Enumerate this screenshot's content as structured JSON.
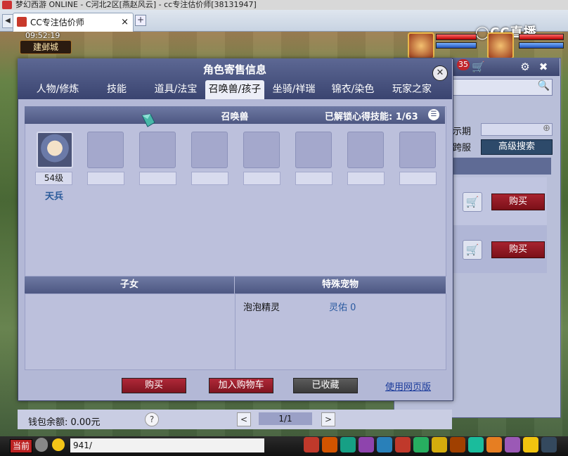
{
  "window": {
    "title": "梦幻西游 ONLINE - C河北2区[燕赵风云] - cc专注估价师[38131947]"
  },
  "browser_tab": {
    "label": "CC专注估价师",
    "close": "×",
    "new": "+"
  },
  "hud": {
    "clock": "09:52:19",
    "location": "建邺城",
    "brand": "◯CC直播"
  },
  "market": {
    "badge": "35",
    "filters": {
      "date_label": "示期",
      "server_label": "跨服"
    },
    "advanced_search": "高级搜索",
    "rows": [
      {
        "buy": "购买"
      },
      {
        "buy": "购买"
      }
    ]
  },
  "dialog": {
    "title": "角色寄售信息",
    "close": "✕",
    "tabs": [
      {
        "label": "人物/修炼"
      },
      {
        "label": "技能"
      },
      {
        "label": "道具/法宝"
      },
      {
        "label": "召唤兽/孩子"
      },
      {
        "label": "坐骑/祥瑞"
      },
      {
        "label": "锦衣/染色"
      },
      {
        "label": "玩家之家"
      }
    ],
    "summon": {
      "title": "召唤兽",
      "skill_label": "已解锁心得技能:",
      "skill_value": "1/63",
      "pets": [
        {
          "level": "54级",
          "name": "天兵"
        }
      ]
    },
    "children": {
      "title": "子女"
    },
    "special": {
      "title": "特殊宠物",
      "name": "泡泡精灵",
      "bless": "灵佑 0"
    },
    "buttons": {
      "buy": "购买",
      "add_cart": "加入购物车",
      "favorited": "已收藏",
      "web": "使用网页版"
    }
  },
  "footer": {
    "wallet": "钱包余额: 0.00元",
    "help": "?",
    "prev": "<",
    "page": "1/1",
    "next": ">"
  },
  "chat": {
    "channel": "当前",
    "input": "941/"
  },
  "colors": {
    "accent_header": "#4d5782",
    "buy_red": "#a8232f",
    "panel_bg": "#bcc0dc"
  }
}
